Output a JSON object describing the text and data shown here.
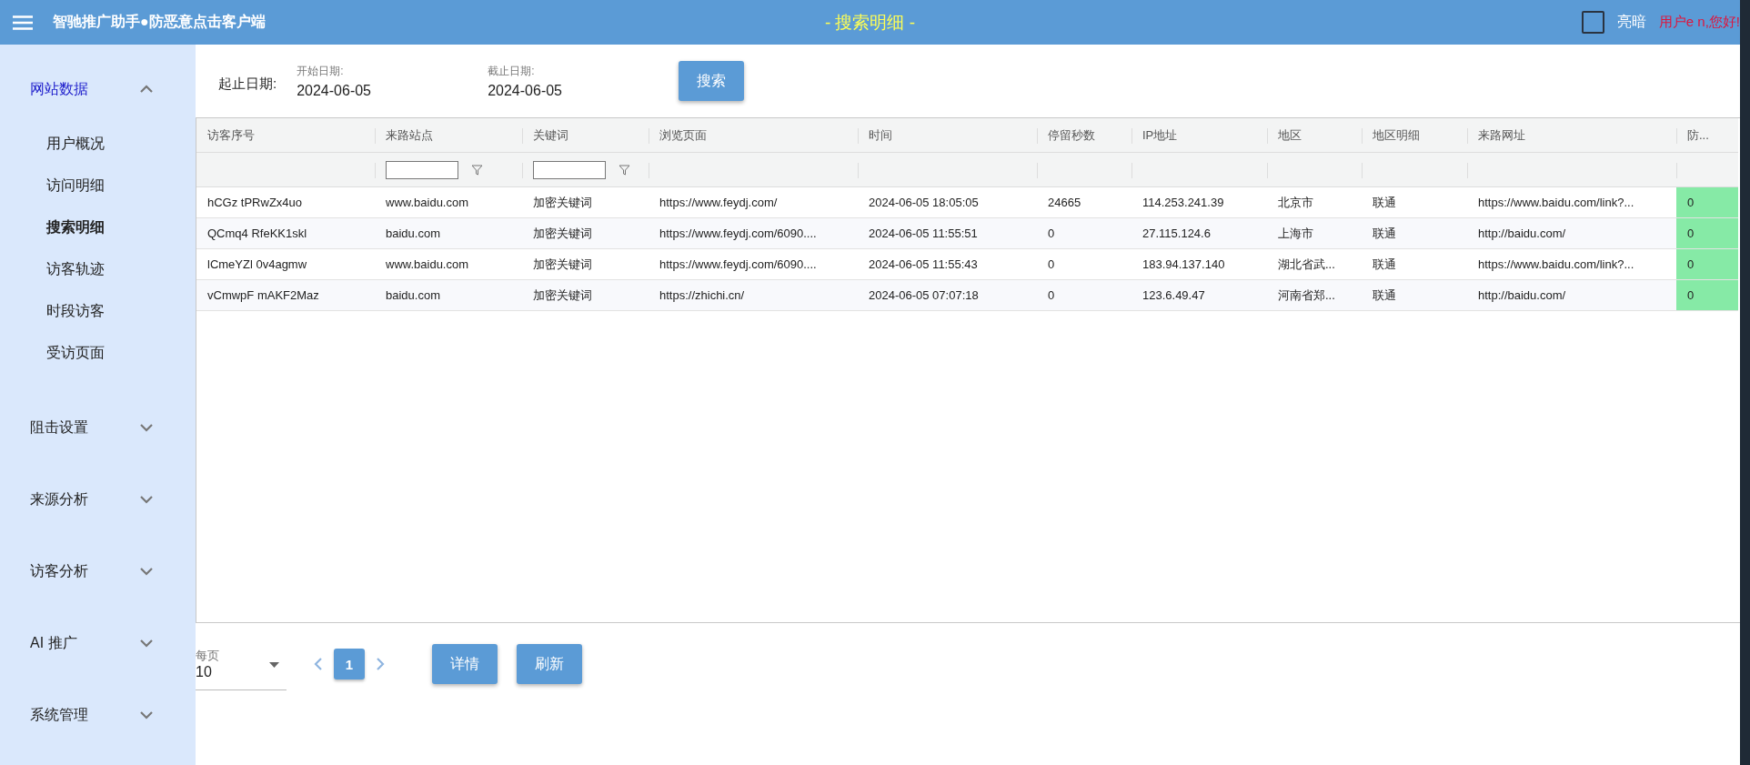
{
  "header": {
    "title": "智驰推广助手●防恶意点击客户端",
    "page_title": "- 搜索明细 -",
    "theme_toggle": {
      "label": "亮暗",
      "checked": false
    },
    "user": "用户e n,您好!"
  },
  "sidebar": {
    "groups": [
      {
        "label": "网站数据",
        "expanded": true,
        "children": [
          {
            "label": "用户概况",
            "selected": false
          },
          {
            "label": "访问明细",
            "selected": false
          },
          {
            "label": "搜索明细",
            "selected": true
          },
          {
            "label": "访客轨迹",
            "selected": false
          },
          {
            "label": "时段访客",
            "selected": false
          },
          {
            "label": "受访页面",
            "selected": false
          }
        ]
      },
      {
        "label": "阻击设置",
        "expanded": false
      },
      {
        "label": "来源分析",
        "expanded": false
      },
      {
        "label": "访客分析",
        "expanded": false
      },
      {
        "label": "AI 推广",
        "expanded": false
      },
      {
        "label": "系统管理",
        "expanded": false
      }
    ]
  },
  "filters": {
    "label": "起止日期:",
    "start": {
      "label": "开始日期:",
      "value": "2024-06-05"
    },
    "end": {
      "label": "截止日期:",
      "value": "2024-06-05"
    },
    "search_button": "搜索"
  },
  "table": {
    "columns": [
      {
        "label": "访客序号",
        "filter": false,
        "highlighted": false
      },
      {
        "label": "来路站点",
        "filter": true,
        "highlighted": false
      },
      {
        "label": "关键词",
        "filter": true,
        "highlighted": false
      },
      {
        "label": "浏览页面",
        "filter": false,
        "highlighted": false
      },
      {
        "label": "时间",
        "filter": false,
        "highlighted": false
      },
      {
        "label": "停留秒数",
        "filter": false,
        "highlighted": false
      },
      {
        "label": "IP地址",
        "filter": false,
        "highlighted": false
      },
      {
        "label": "地区",
        "filter": false,
        "highlighted": false
      },
      {
        "label": "地区明细",
        "filter": false,
        "highlighted": false
      },
      {
        "label": "来路网址",
        "filter": false,
        "highlighted": false
      },
      {
        "label": "防...",
        "filter": false,
        "highlighted": true
      }
    ],
    "rows": [
      {
        "cells": [
          "hCGz tPRwZx4uo",
          "www.baidu.com",
          "加密关键词",
          "https://www.feydj.com/",
          "2024-06-05 18:05:05",
          "24665",
          "114.253.241.39",
          "北京市",
          "联通",
          "https://www.baidu.com/link?...",
          "0"
        ]
      },
      {
        "cells": [
          "QCmq4 RfeKK1skl",
          "baidu.com",
          "加密关键词",
          "https://www.feydj.com/6090....",
          "2024-06-05 11:55:51",
          "0",
          "27.115.124.6",
          "上海市",
          "联通",
          "http://baidu.com/",
          "0"
        ]
      },
      {
        "cells": [
          "lCmeYZl 0v4agmw",
          "www.baidu.com",
          "加密关键词",
          "https://www.feydj.com/6090....",
          "2024-06-05 11:55:43",
          "0",
          "183.94.137.140",
          "湖北省武...",
          "联通",
          "https://www.baidu.com/link?...",
          "0"
        ]
      },
      {
        "cells": [
          "vCmwpF mAKF2Maz",
          "baidu.com",
          "加密关键词",
          "https://zhichi.cn/",
          "2024-06-05 07:07:18",
          "0",
          "123.6.49.47",
          "河南省郑...",
          "联通",
          "http://baidu.com/",
          "0"
        ]
      }
    ]
  },
  "pagination": {
    "page_size_label": "每页",
    "page_size": "10",
    "pages": [
      {
        "label": "1",
        "selected": true
      }
    ]
  },
  "buttons": [
    "详情",
    "刷新"
  ]
}
